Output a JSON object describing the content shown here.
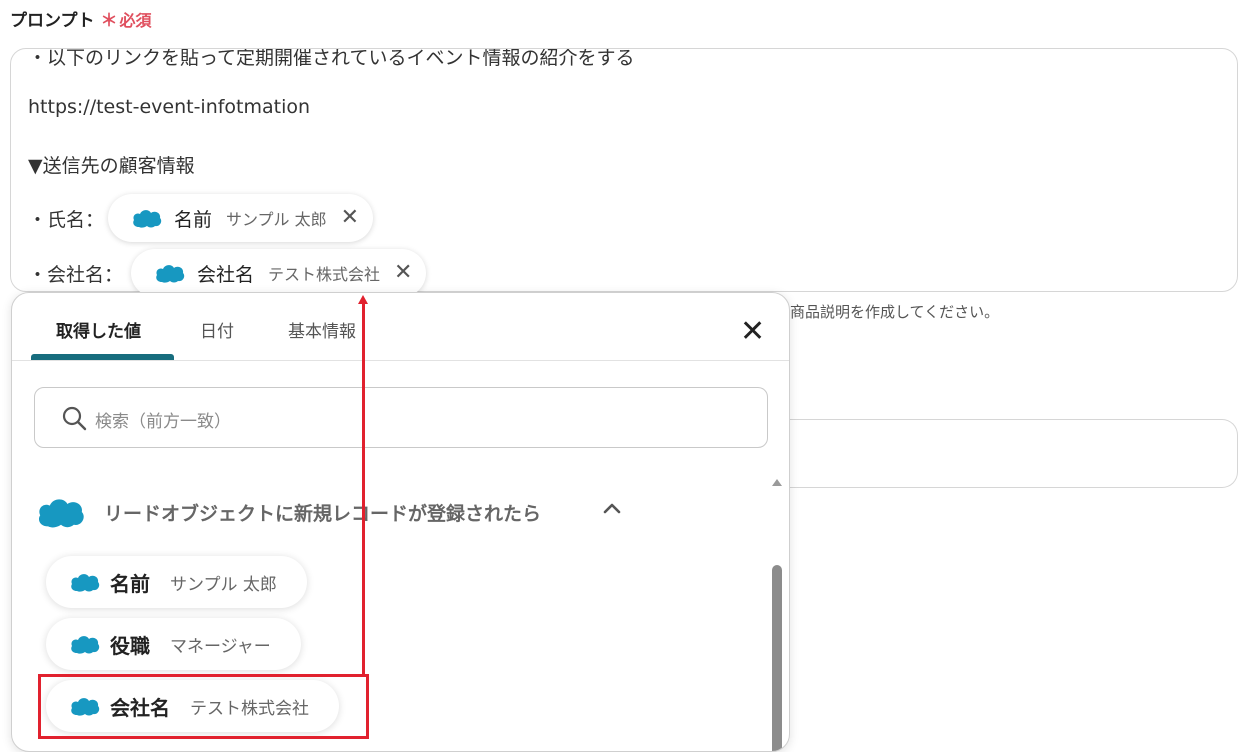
{
  "field": {
    "label": "プロンプト",
    "required_mark": "＊",
    "required_text": "必須"
  },
  "prompt": {
    "lines": [
      "・以下のリンクを貼って定期開催されているイベント情報の紹介をする",
      "https://test-event-infotmation",
      "▼送信先の顧客情報",
      "・氏名：",
      "・会社名："
    ],
    "chips": [
      {
        "key": "名前",
        "value": "サンプル 太郎"
      },
      {
        "key": "会社名",
        "value": "テスト株式会社"
      }
    ],
    "remove_glyph": "✕"
  },
  "hint_text": "商品説明を作成してください。",
  "popup": {
    "tabs": [
      "取得した値",
      "日付",
      "基本情報"
    ],
    "active_tab": "取得した値",
    "close_glyph": "✕",
    "search_placeholder": "検索（前方一致）",
    "group": {
      "title": "リードオブジェクトに新規レコードが登録されたら",
      "expanded": true,
      "items": [
        {
          "key": "名前",
          "value": "サンプル 太郎"
        },
        {
          "key": "役職",
          "value": "マネージャー"
        },
        {
          "key": "会社名",
          "value": "テスト株式会社",
          "highlighted": true
        }
      ]
    }
  },
  "icons": {
    "salesforce": "salesforce-cloud-icon",
    "search": "search-icon",
    "chevron": "chevron-up-icon",
    "close": "close-icon"
  },
  "colors": {
    "salesforce_blue": "#1798c1",
    "accent_teal": "#176d7e",
    "required_red": "#e0505f",
    "annotation_red": "#e1212e"
  }
}
